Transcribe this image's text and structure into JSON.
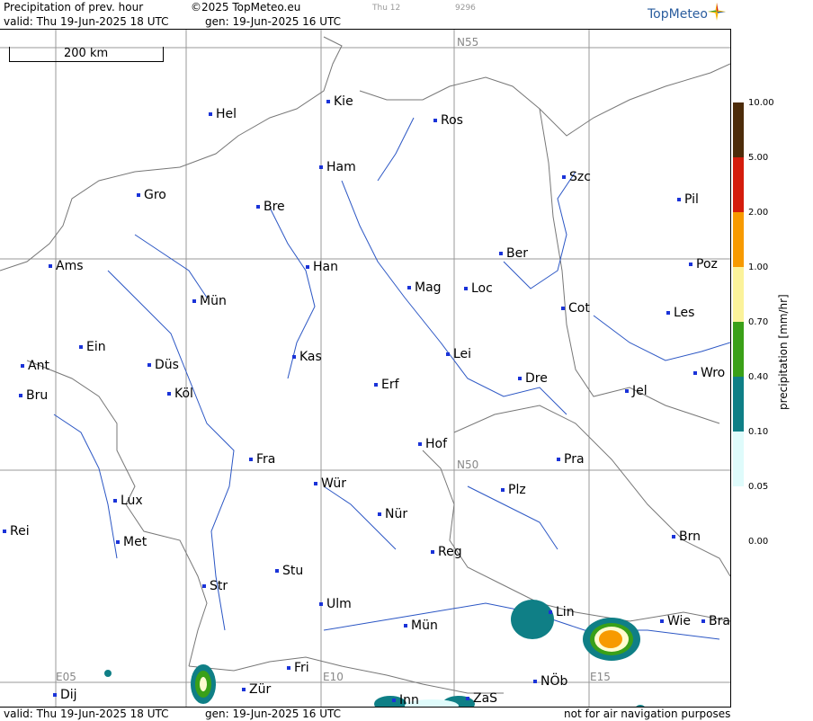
{
  "header": {
    "title": "Precipitation of prev. hour",
    "copyright": "©2025 TopMeteo.eu",
    "valid": "valid:  Thu  19-Jun-2025  18 UTC",
    "gen": "gen: 19-Jun-2025 16 UTC",
    "small1": "Thu 12",
    "small2": "9296",
    "brand": "TopMeteo"
  },
  "scale_label": "200 km",
  "grid_labels": [
    "N55",
    "N50",
    "E05",
    "E10",
    "E15"
  ],
  "cities": [
    "Kie",
    "Hel",
    "Ros",
    "Ham",
    "Szc",
    "Gro",
    "Bre",
    "Pil",
    "Ber",
    "Ams",
    "Han",
    "Poz",
    "Mag",
    "Loc",
    "Mün",
    "Cot",
    "Les",
    "Ein",
    "Kas",
    "Lei",
    "Ant",
    "Düs",
    "Wro",
    "Dre",
    "Erf",
    "Köl",
    "Jel",
    "Bru",
    "Hof",
    "Fra",
    "Pra",
    "Wür",
    "Plz",
    "Lux",
    "Rei",
    "Nür",
    "Met",
    "Brn",
    "Reg",
    "Stu",
    "Str",
    "Ulm",
    "Lin",
    "Wie",
    "Bra",
    "Mün",
    "Fri",
    "NÖb",
    "Dij",
    "Zür",
    "Inn",
    "ZaS"
  ],
  "legend": {
    "unit": "precipitation  [mm/hr]",
    "ticks": [
      "10.00",
      "5.00",
      "2.00",
      "1.00",
      "0.70",
      "0.40",
      "0.10",
      "0.05",
      "0.00"
    ],
    "colors": [
      "#4d2c0a",
      "#d41c0c",
      "#f79a00",
      "#fbf29a",
      "#fffbd0",
      "#3aa018",
      "#0f7f86",
      "#dffbfb",
      "#ffffff"
    ]
  },
  "footer": {
    "valid": "valid:  Thu  19-Jun-2025  18 UTC",
    "gen": "gen: 19-Jun-2025 16 UTC",
    "note": "not for air navigation purposes"
  }
}
